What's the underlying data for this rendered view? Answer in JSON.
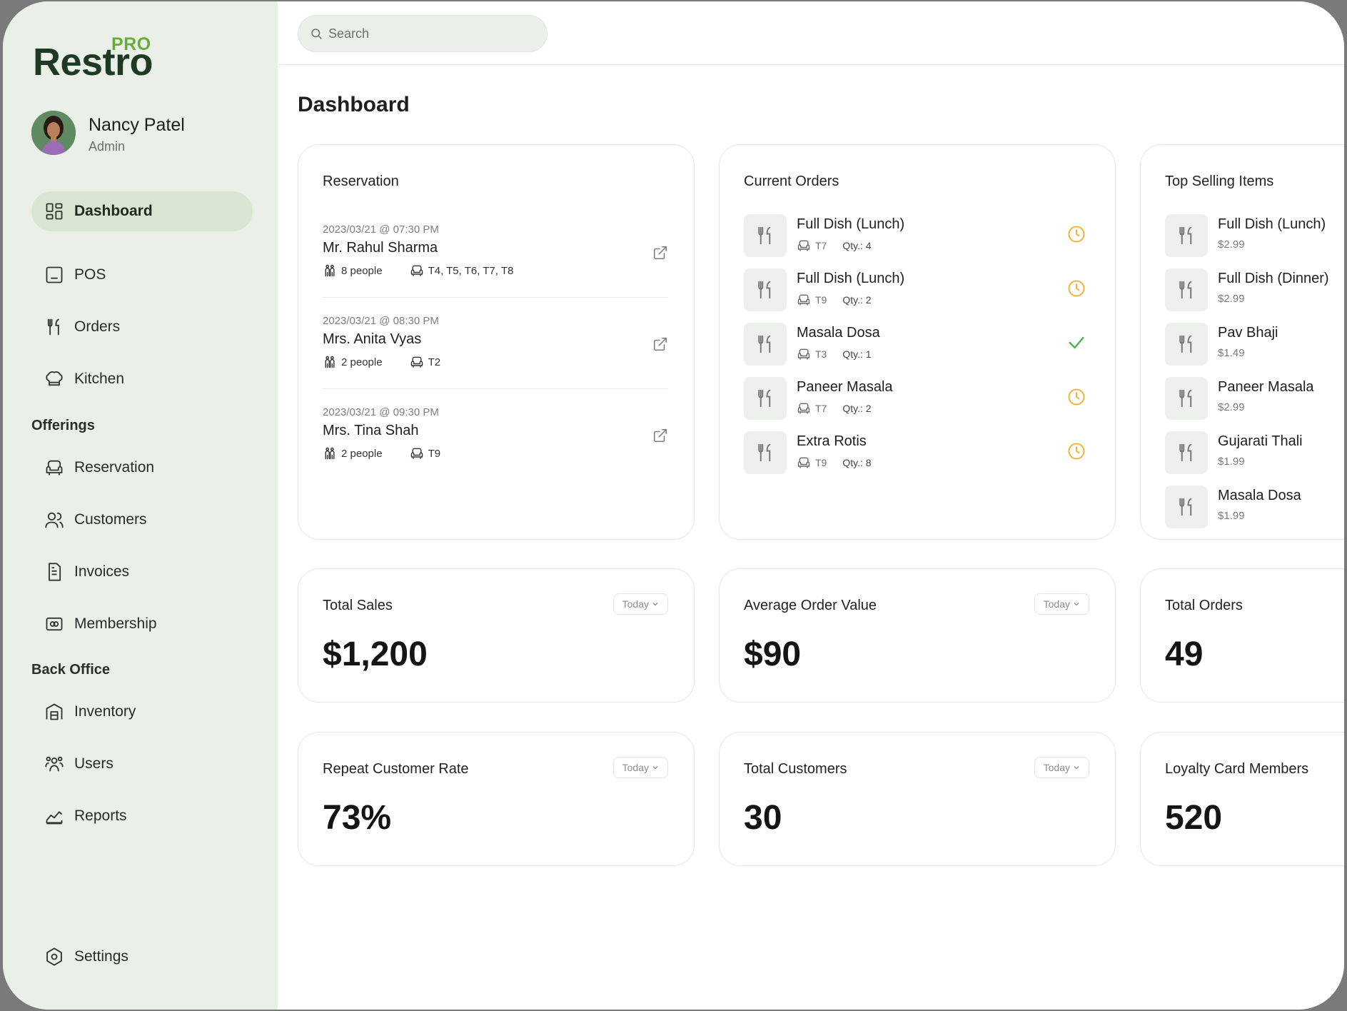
{
  "brand": {
    "name": "Restro",
    "badge": "PRO"
  },
  "user": {
    "name": "Nancy Patel",
    "role": "Admin"
  },
  "nav": {
    "dashboard": "Dashboard",
    "pos": "POS",
    "orders": "Orders",
    "kitchen": "Kitchen",
    "offerings_heading": "Offerings",
    "reservation": "Reservation",
    "customers": "Customers",
    "invoices": "Invoices",
    "membership": "Membership",
    "back_office_heading": "Back Office",
    "inventory": "Inventory",
    "users": "Users",
    "reports": "Reports",
    "settings": "Settings"
  },
  "search": {
    "placeholder": "Search"
  },
  "page_title": "Dashboard",
  "reservation_card": {
    "title": "Reservation",
    "items": [
      {
        "datetime": "2023/03/21 @ 07:30 PM",
        "name": "Mr. Rahul Sharma",
        "people": "8 people",
        "tables": "T4, T5, T6, T7, T8"
      },
      {
        "datetime": "2023/03/21 @ 08:30 PM",
        "name": "Mrs. Anita Vyas",
        "people": "2 people",
        "tables": "T2"
      },
      {
        "datetime": "2023/03/21 @ 09:30 PM",
        "name": "Mrs. Tina Shah",
        "people": "2 people",
        "tables": "T9"
      }
    ]
  },
  "orders_card": {
    "title": "Current Orders",
    "items": [
      {
        "name": "Full Dish (Lunch)",
        "table": "T7",
        "qty": "Qty.: 4",
        "status": "pending"
      },
      {
        "name": "Full Dish (Lunch)",
        "table": "T9",
        "qty": "Qty.: 2",
        "status": "pending"
      },
      {
        "name": "Masala Dosa",
        "table": "T3",
        "qty": "Qty.: 1",
        "status": "done"
      },
      {
        "name": "Paneer Masala",
        "table": "T7",
        "qty": "Qty.: 2",
        "status": "pending"
      },
      {
        "name": "Extra Rotis",
        "table": "T9",
        "qty": "Qty.: 8",
        "status": "pending"
      }
    ]
  },
  "top_selling_card": {
    "title": "Top Selling Items",
    "items": [
      {
        "name": "Full Dish (Lunch)",
        "price": "$2.99"
      },
      {
        "name": "Full Dish (Dinner)",
        "price": "$2.99"
      },
      {
        "name": "Pav Bhaji",
        "price": "$1.49"
      },
      {
        "name": "Paneer Masala",
        "price": "$2.99"
      },
      {
        "name": "Gujarati Thali",
        "price": "$1.99"
      },
      {
        "name": "Masala Dosa",
        "price": "$1.99"
      }
    ]
  },
  "stats": {
    "total_sales": {
      "label": "Total Sales",
      "value": "$1,200",
      "period": "Today"
    },
    "avg_order_value": {
      "label": "Average Order Value",
      "value": "$90",
      "period": "Today"
    },
    "total_orders": {
      "label": "Total Orders",
      "value": "49"
    },
    "repeat_customer_rate": {
      "label": "Repeat Customer Rate",
      "value": "73%",
      "period": "Today"
    },
    "total_customers": {
      "label": "Total Customers",
      "value": "30",
      "period": "Today"
    },
    "loyalty_members": {
      "label": "Loyalty Card Members",
      "value": "520"
    }
  },
  "colors": {
    "sidebar_bg": "#eaf0e8",
    "brand_green": "#6aab3e",
    "brand_dark": "#1f3a22",
    "pending": "#f2b33d",
    "done": "#4caf50"
  },
  "icons": {
    "pending": "clock-icon",
    "done": "check-icon",
    "dish": "fork-knife-icon",
    "table": "armchair-icon",
    "people": "people-icon",
    "link": "external-link-icon"
  }
}
